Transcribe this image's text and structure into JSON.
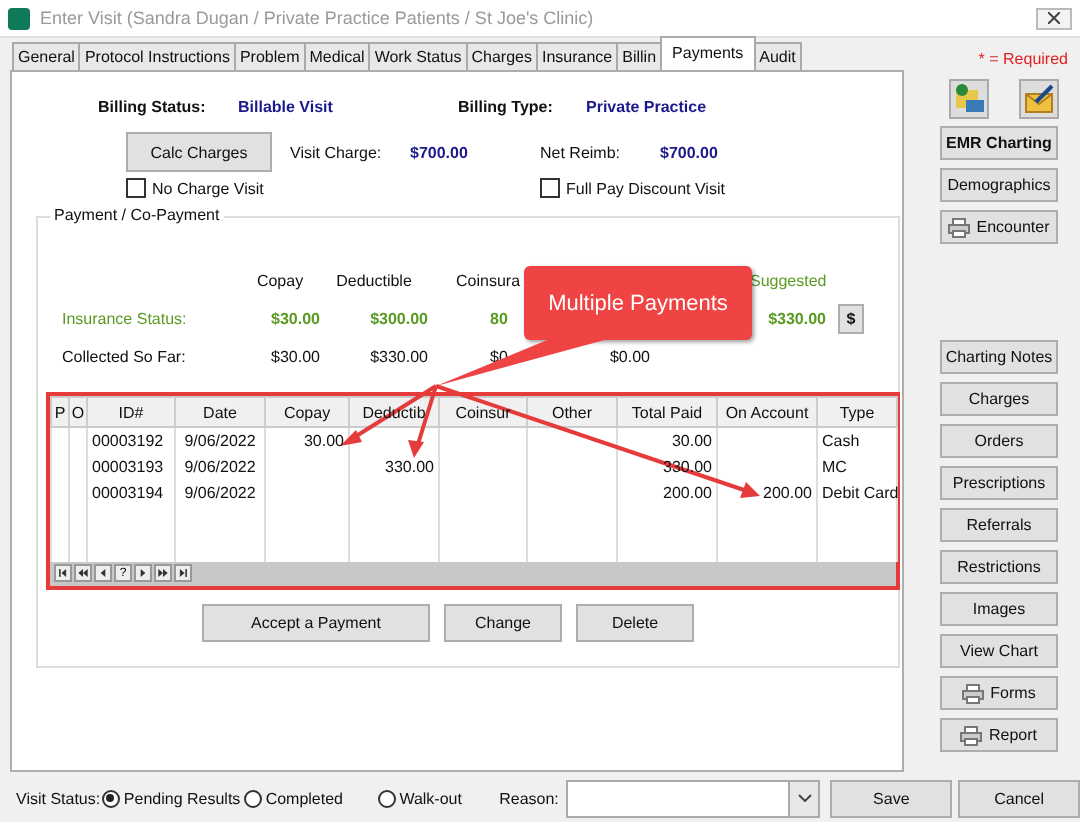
{
  "window": {
    "title": "Enter Visit (Sandra Dugan / Private Practice Patients / St Joe's Clinic)"
  },
  "tabs": [
    {
      "label": "General",
      "selected": false
    },
    {
      "label": "Protocol Instructions",
      "selected": false
    },
    {
      "label": "Problem",
      "selected": false
    },
    {
      "label": "Medical",
      "selected": false
    },
    {
      "label": "Work Status",
      "selected": false
    },
    {
      "label": "Charges",
      "selected": false
    },
    {
      "label": "Insurance",
      "selected": false
    },
    {
      "label": "Billin",
      "selected": false
    },
    {
      "label": "Payments",
      "selected": true
    },
    {
      "label": "Audit",
      "selected": false
    }
  ],
  "required_note": "* = Required",
  "billing": {
    "status_label": "Billing Status:",
    "status_value": "Billable Visit",
    "type_label": "Billing Type:",
    "type_value": "Private Practice"
  },
  "charges": {
    "button": "Calc Charges",
    "visit_charge_label": "Visit Charge:",
    "visit_charge_value": "$700.00",
    "net_reimb_label": "Net Reimb:",
    "net_reimb_value": "$700.00"
  },
  "checkboxes": [
    {
      "label": "No Charge Visit",
      "checked": false
    },
    {
      "label": "Full Pay Discount Visit",
      "checked": false
    }
  ],
  "payment_group": {
    "title": "Payment / Co-Payment",
    "columns": {
      "copay": "Copay",
      "deductible": "Deductible",
      "coinsurance": "Coinsura",
      "suggested": "Suggested"
    },
    "rows": [
      {
        "label": "Insurance Status:",
        "kind": "status",
        "copay": "$30.00",
        "deductible": "$300.00",
        "coinsurance": "80",
        "suggested": "$330.00"
      },
      {
        "label": "Collected So Far:",
        "kind": "collected",
        "copay": "$30.00",
        "deductible": "$330.00",
        "coinsurance": "$0",
        "column_5": "$0.00"
      }
    ],
    "dollar_button": "$"
  },
  "grid": {
    "columns": [
      "P",
      "O",
      "ID#",
      "Date",
      "Copay",
      "Deductib",
      "Coinsur",
      "Other",
      "Total Paid",
      "On Account",
      "Type"
    ],
    "rows": [
      {
        "id": "00003192",
        "date": "9/06/2022",
        "copay": "30.00",
        "total_paid": "30.00",
        "type": "Cash"
      },
      {
        "id": "00003193",
        "date": "9/06/2022",
        "deductible": "330.00",
        "total_paid": "330.00",
        "type": "MC"
      },
      {
        "id": "00003194",
        "date": "9/06/2022",
        "total_paid": "200.00",
        "on_account": "200.00",
        "type": "Debit Card"
      }
    ],
    "nav_label": "?"
  },
  "callout": {
    "text": "Multiple Payments"
  },
  "actions": [
    "Accept a Payment",
    "Change",
    "Delete"
  ],
  "side_top": [
    {
      "label": "EMR Charting",
      "kind": "bold"
    },
    {
      "label": "Demographics",
      "kind": "plain"
    },
    {
      "label": "Encounter",
      "kind": "print"
    }
  ],
  "side_bottom": [
    {
      "label": "Charting Notes",
      "kind": "plain"
    },
    {
      "label": "Charges",
      "kind": "plain"
    },
    {
      "label": "Orders",
      "kind": "plain"
    },
    {
      "label": "Prescriptions",
      "kind": "plain"
    },
    {
      "label": "Referrals",
      "kind": "plain"
    },
    {
      "label": "Restrictions",
      "kind": "plain"
    },
    {
      "label": "Images",
      "kind": "plain"
    },
    {
      "label": "View Chart",
      "kind": "plain"
    },
    {
      "label": "Forms",
      "kind": "print"
    },
    {
      "label": "Report",
      "kind": "print"
    }
  ],
  "visit_status": {
    "label": "Visit Status:",
    "options": [
      {
        "label": "Pending Results",
        "selected": true
      },
      {
        "label": "Completed",
        "selected": false
      },
      {
        "label": "Walk-out",
        "selected": false
      }
    ]
  },
  "reason": {
    "label": "Reason:"
  },
  "buttons": [
    "Save",
    "Cancel"
  ]
}
